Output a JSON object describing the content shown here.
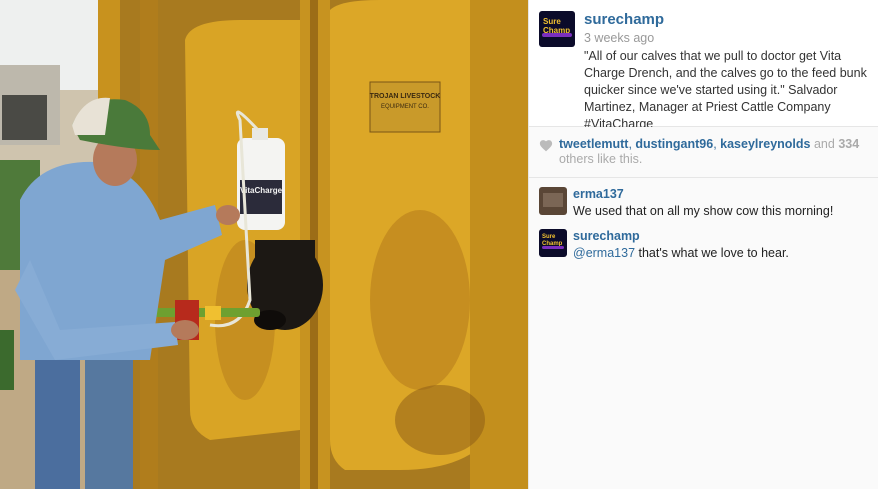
{
  "post": {
    "username": "surechamp",
    "time_ago": "3 weeks ago",
    "caption": "\"All of our calves that we pull to doctor get Vita Charge Drench, and the calves go to the feed bunk quicker since we've started using it.\" Salvador Martinez, Manager at Priest Cattle Company #VitaCharge",
    "avatar_text_line1": "Sure",
    "avatar_text_line2": "Champ",
    "photo": {
      "gate_sign_line1": "TROJAN LIVESTOCK",
      "gate_sign_line2": "EQUIPMENT CO.",
      "jug_label": "VitaCharge"
    }
  },
  "likes": {
    "users": [
      "tweetlemutt",
      "dustingant96",
      "kaseylreynolds"
    ],
    "and_word": "and",
    "count": "334",
    "suffix": "others like this."
  },
  "comments": [
    {
      "username": "erma137",
      "text": "We used that on all my show cow this morning!",
      "mention": ""
    },
    {
      "username": "surechamp",
      "mention": "@erma137",
      "text": " that's what we love to hear."
    }
  ],
  "colors": {
    "link_blue": "#2f6a9b",
    "muted": "#999999",
    "gate_yellow": "#d9a425",
    "shirt_blue": "#7fa6d1"
  }
}
